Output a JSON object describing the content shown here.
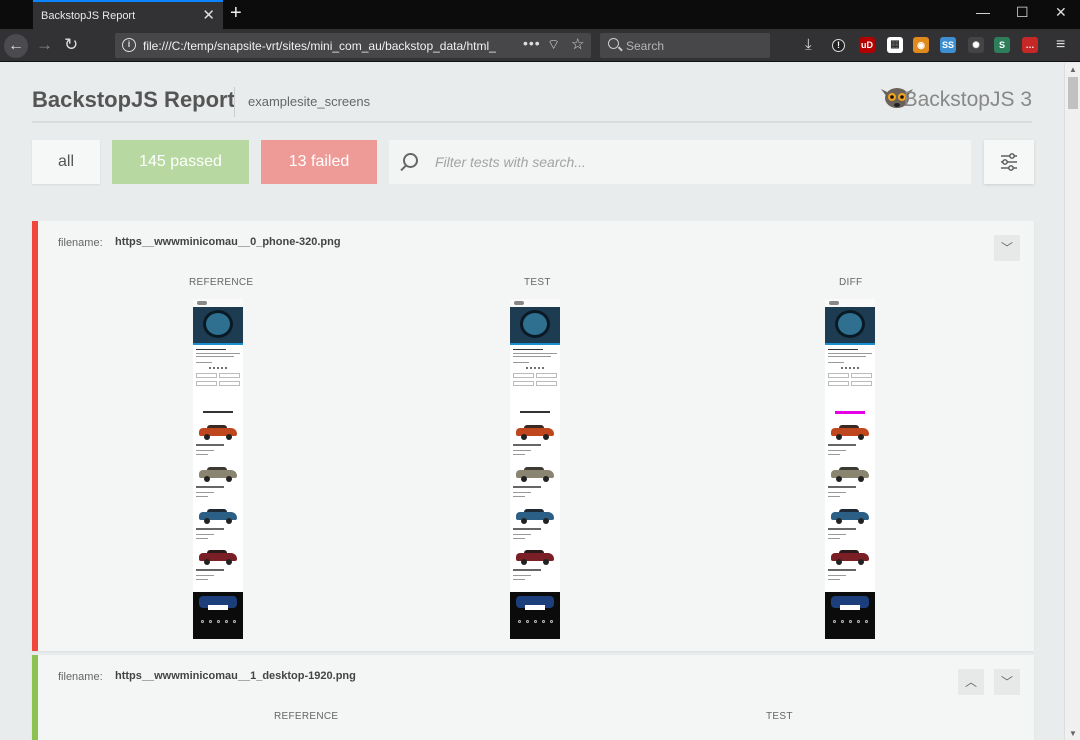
{
  "browser": {
    "tab_title": "BackstopJS Report",
    "tab_close": "✕",
    "new_tab": "+",
    "win_min": "—",
    "win_max": "☐",
    "win_close": "✕",
    "url": "file:///C:/temp/snapsite-vrt/sites/mini_com_au/backstop_data/html_",
    "url_more": "•••",
    "search_placeholder": "Search",
    "icons": [
      "back-icon",
      "forward-icon",
      "reload-icon",
      "info-icon",
      "tracking-icon",
      "bookmark-star-icon",
      "download-icon",
      "menu-icon"
    ],
    "extensions": [
      {
        "name": "ublock-extension-icon",
        "label": "uD",
        "color": "#b50000"
      },
      {
        "name": "qr-extension-icon",
        "label": "▦",
        "color": "#666666"
      },
      {
        "name": "fox-extension-icon",
        "label": "◉",
        "color": "#e08a1e"
      },
      {
        "name": "seo-extension-icon",
        "label": "SS",
        "color": "#3d8fd1"
      },
      {
        "name": "react-extension-icon",
        "label": "✺",
        "color": "#444444"
      },
      {
        "name": "stylus-extension-icon",
        "label": "S",
        "color": "#2e7d5b"
      },
      {
        "name": "lastpass-extension-icon",
        "label": "…",
        "color": "#c62828"
      }
    ]
  },
  "header": {
    "title": "BackstopJS Report",
    "subtitle": "examplesite_screens",
    "brand": "BackstopJS 3"
  },
  "filters": {
    "all_label": "all",
    "passed_label": "145 passed",
    "failed_label": "13 failed",
    "search_placeholder": "Filter tests with search...",
    "colors": {
      "passed": "#b7d9a1",
      "failed": "#ee9b98"
    }
  },
  "tests": [
    {
      "status": "failed",
      "status_color": "#f0473d",
      "filename_label": "filename:",
      "filename": "https__wwwminicomau__0_phone-320.png",
      "columns": [
        "REFERENCE",
        "TEST",
        "DIFF"
      ],
      "toggle": "⌄"
    },
    {
      "status": "passed",
      "status_color": "#8dc252",
      "filename_label": "filename:",
      "filename": "https__wwwminicomau__1_desktop-1920.png",
      "columns": [
        "REFERENCE",
        "TEST"
      ],
      "toggle_up": "⌃",
      "toggle_down": "⌄"
    }
  ]
}
